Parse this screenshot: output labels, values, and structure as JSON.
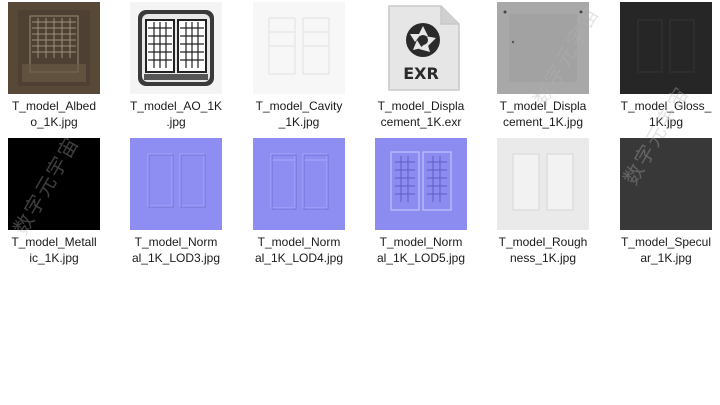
{
  "files": [
    {
      "name": "T_model_Albedo_1K.jpg",
      "label_l1": "T_model_Albed",
      "label_l2": "o_1K.jpg",
      "kind": "albedo",
      "icon": "image-thumbnail"
    },
    {
      "name": "T_model_AO_1K.jpg",
      "label_l1": "T_model_AO_1K",
      "label_l2": ".jpg",
      "kind": "ao",
      "icon": "image-thumbnail"
    },
    {
      "name": "T_model_Cavity_1K.jpg",
      "label_l1": "T_model_Cavity",
      "label_l2": "_1K.jpg",
      "kind": "cavity",
      "icon": "image-thumbnail"
    },
    {
      "name": "T_model_Displacement_1K.exr",
      "label_l1": "T_model_Displa",
      "label_l2": "cement_1K.exr",
      "kind": "exr",
      "icon": "exr-file-icon",
      "badge": "EXR"
    },
    {
      "name": "T_model_Displacement_1K.jpg",
      "label_l1": "T_model_Displa",
      "label_l2": "cement_1K.jpg",
      "kind": "disp",
      "icon": "image-thumbnail"
    },
    {
      "name": "T_model_Gloss_1K.jpg",
      "label_l1": "T_model_Gloss_",
      "label_l2": "1K.jpg",
      "kind": "gloss",
      "icon": "image-thumbnail"
    },
    {
      "name": "T_model_Metallic_1K.jpg",
      "label_l1": "T_model_Metall",
      "label_l2": "ic_1K.jpg",
      "kind": "metal",
      "icon": "image-thumbnail"
    },
    {
      "name": "T_model_Normal_1K_LOD3.jpg",
      "label_l1": "T_model_Norm",
      "label_l2": "al_1K_LOD3.jpg",
      "kind": "normal",
      "icon": "image-thumbnail"
    },
    {
      "name": "T_model_Normal_1K_LOD4.jpg",
      "label_l1": "T_model_Norm",
      "label_l2": "al_1K_LOD4.jpg",
      "kind": "normal",
      "icon": "image-thumbnail"
    },
    {
      "name": "T_model_Normal_1K_LOD5.jpg",
      "label_l1": "T_model_Norm",
      "label_l2": "al_1K_LOD5.jpg",
      "kind": "normal5",
      "icon": "image-thumbnail"
    },
    {
      "name": "T_model_Roughness_1K.jpg",
      "label_l1": "T_model_Rough",
      "label_l2": "ness_1K.jpg",
      "kind": "rough",
      "icon": "image-thumbnail"
    },
    {
      "name": "T_model_Specular_1K.jpg",
      "label_l1": "T_model_Specul",
      "label_l2": "ar_1K.jpg",
      "kind": "spec",
      "icon": "image-thumbnail"
    }
  ],
  "colors": {
    "albedo": "#5a4a3a",
    "ao": "#f2f2f2",
    "cavity": "#f6f6f6",
    "exr_bg": "#e3e3e3",
    "disp": "#a9a9a9",
    "gloss": "#2a2a2a",
    "metal": "#000000",
    "normal": "#8c8cf0",
    "rough": "#ececec",
    "spec": "#3a3a3a"
  },
  "watermarks": [
    "数字元宇宙",
    "数字元宇宙",
    "数字元宇宙"
  ]
}
